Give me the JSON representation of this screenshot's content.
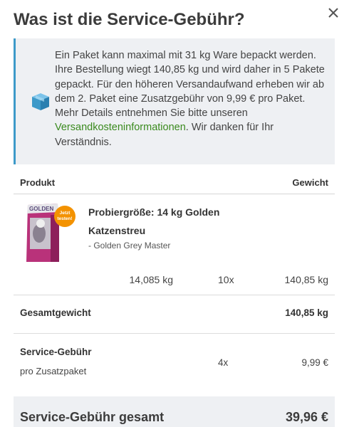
{
  "dialog": {
    "title": "Was ist die Service-Gebühr?",
    "close_icon": "close-icon"
  },
  "info": {
    "icon": "box-icon",
    "text_before_link": "Ein Paket kann maximal mit 31 kg Ware bepackt werden. Ihre Bestellung wiegt 140,85 kg und wird daher in 5 Pakete gepackt. Für den höheren Versandaufwand erheben wir ab dem 2. Paket eine Zusatzgebühr von 9,99 € pro Paket. Mehr Details entnehmen Sie bitte unseren ",
    "link_text": "Versandkosteninformationen",
    "text_after_link": ". Wir danken für Ihr Verständnis."
  },
  "table": {
    "header_product": "Produkt",
    "header_weight": "Gewicht",
    "product": {
      "name": "Probiergröße: 14 kg Golden Katzenstreu",
      "brand": "- Golden Grey Master",
      "badge_line1": "Jetzt",
      "badge_line2": "testen!",
      "pack_label": "GOLDEN",
      "unit_weight": "14,085 kg",
      "quantity": "10x",
      "total_weight": "140,85 kg"
    },
    "total_weight_label": "Gesamtgewicht",
    "total_weight_value": "140,85 kg",
    "fee_label": "Service-Gebühr",
    "fee_sublabel": "pro Zusatzpaket",
    "fee_quantity": "4x",
    "fee_price": "9,99 €",
    "grand_label": "Service-Gebühr gesamt",
    "grand_value": "39,96 €"
  },
  "colors": {
    "accent": "#3d9ac9",
    "link": "#3a8a1e",
    "info_bg": "#eef0f3",
    "badge": "#f39200"
  }
}
